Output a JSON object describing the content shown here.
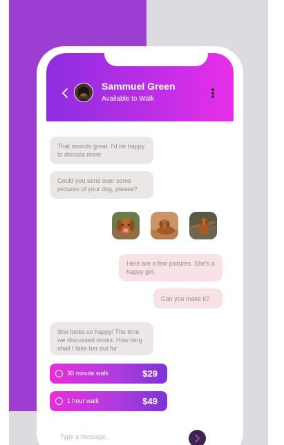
{
  "header": {
    "contact_name": "Sammuel Green",
    "contact_status": "Available to Walk"
  },
  "messages": [
    {
      "direction": "in",
      "text": "That sounds great. I'd be happy to discuss more"
    },
    {
      "direction": "in",
      "text": "Could you send over some pictures of your dog, please?"
    },
    {
      "direction": "out",
      "text": "Here are a few pictures. She's a happy girl."
    },
    {
      "direction": "out",
      "text": "Can you make it?"
    },
    {
      "direction": "in",
      "text": "She looks so happy! The time we discussed works. How long shall I take her out for"
    }
  ],
  "photos": [
    {
      "icon": "dog-photo-1"
    },
    {
      "icon": "dog-photo-2"
    },
    {
      "icon": "dog-photo-3"
    }
  ],
  "options": [
    {
      "label": "30 minute walk",
      "price": "$29"
    },
    {
      "label": "1 hour walk",
      "price": "$49"
    }
  ],
  "composer": {
    "placeholder": "Type a message_"
  },
  "colors": {
    "accent_start": "#8d2ee0",
    "accent_end": "#e92ee9",
    "background_panel": "#9b3ed1",
    "send_button": "#3e2350"
  }
}
